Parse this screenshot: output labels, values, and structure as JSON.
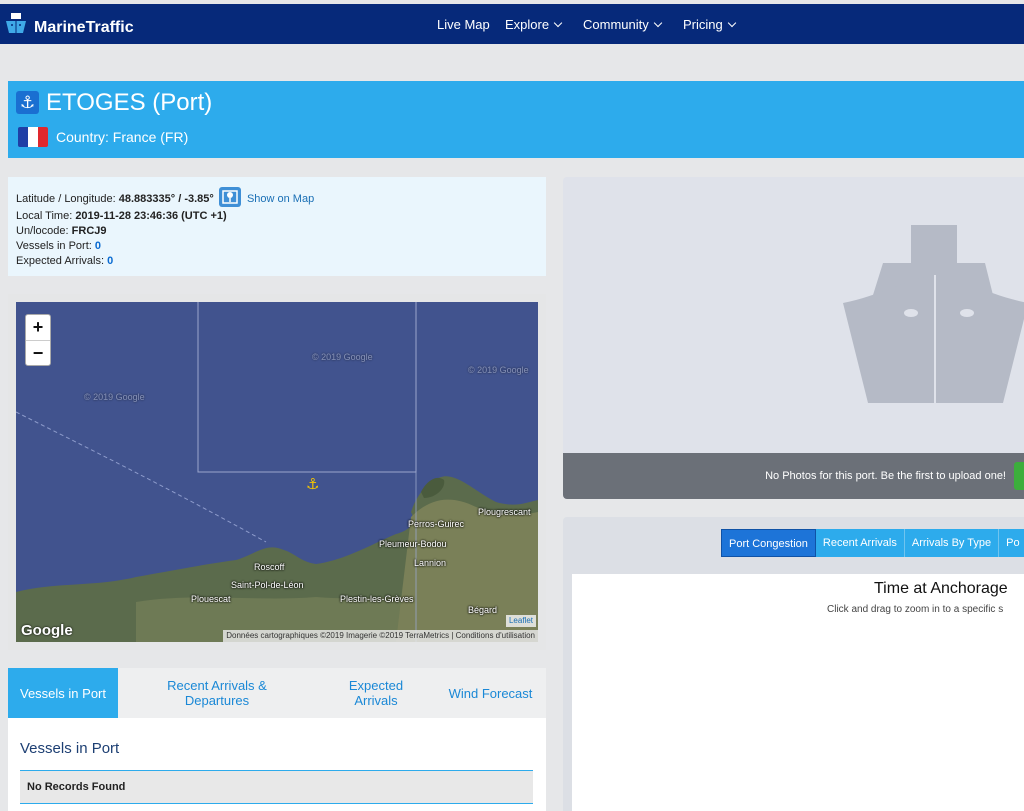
{
  "app": {
    "name": "MarineTraffic"
  },
  "nav": {
    "items": [
      {
        "label": "Live Map"
      },
      {
        "label": "Explore"
      },
      {
        "label": "Community"
      },
      {
        "label": "Pricing"
      }
    ]
  },
  "port": {
    "title": "ETOGES (Port)",
    "country": "Country: France (FR)"
  },
  "info": {
    "latlon_label": "Latitude / Longitude:",
    "latlon_value": "48.883335° / -3.85°",
    "show_on_map": "Show on Map",
    "local_time_label": "Local Time:",
    "local_time_value": "2019-11-28 23:46:36 (UTC +1)",
    "unlocode_label": "Un/locode:",
    "unlocode_value": "FRCJ9",
    "vessels_label": "Vessels in Port:",
    "vessels_value": "0",
    "arrivals_label": "Expected Arrivals:",
    "arrivals_value": "0"
  },
  "map": {
    "zoom_in": "+",
    "zoom_out": "−",
    "google": "Google",
    "leaflet": "Leaflet",
    "attribution": "Données cartographiques ©2019 Imagerie ©2019 TerraMetrics | Conditions d'utilisation",
    "watermark": "© 2019 Google",
    "places": {
      "roscoff": "Roscoff",
      "saint_pol": "Saint-Pol-de-Léon",
      "plouescat": "Plouescat",
      "plestin": "Plestin-les-Grèves",
      "perros": "Perros-Guirec",
      "pleumeur": "Pleumeur-Bodou",
      "lannion": "Lannion",
      "plougrescant": "Plougrescant",
      "begard": "Bégard"
    }
  },
  "tabs": [
    {
      "label": "Vessels in Port"
    },
    {
      "label": "Recent Arrivals & Departures"
    },
    {
      "label": "Expected Arrivals"
    },
    {
      "label": "Wind Forecast"
    }
  ],
  "vessels_section": {
    "title": "Vessels in Port",
    "empty": "No Records Found"
  },
  "photo": {
    "message": "No Photos for this port. Be the first to upload one!"
  },
  "chart": {
    "tabs": [
      {
        "label": "Port Congestion"
      },
      {
        "label": "Recent Arrivals"
      },
      {
        "label": "Arrivals By Type"
      },
      {
        "label": "Po"
      }
    ],
    "title": "Time at Anchorage",
    "subtitle": "Click and drag to zoom in to a specific s"
  },
  "colors": {
    "nav_bg": "#06297a",
    "accent": "#2dabec",
    "active_chart_tab": "#1d74d8"
  }
}
